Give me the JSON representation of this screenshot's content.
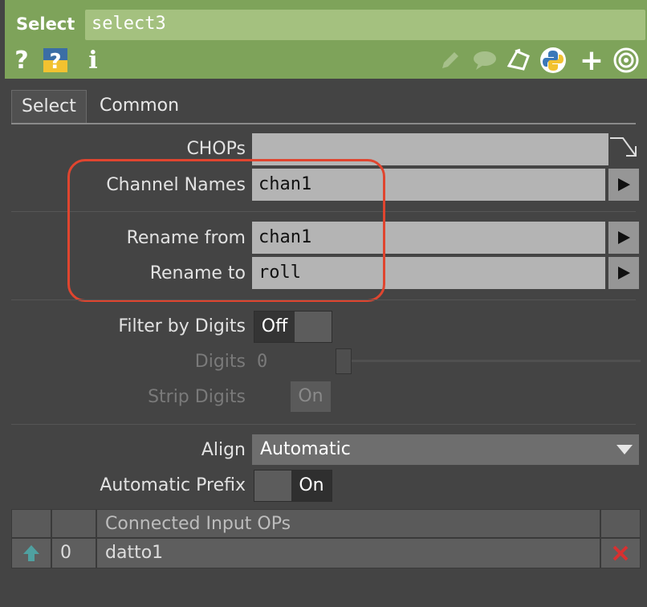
{
  "header": {
    "op_type": "Select",
    "op_name": "select3",
    "left_icons": [
      "help-icon",
      "python-help-icon",
      "info-icon"
    ],
    "right_icons": [
      "edit-icon",
      "comment-icon",
      "clone-icon",
      "python-icon",
      "add-icon",
      "target-icon"
    ]
  },
  "tabs": [
    {
      "label": "Select",
      "active": true
    },
    {
      "label": "Common",
      "active": false
    }
  ],
  "params": {
    "chops": {
      "label": "CHOPs",
      "value": ""
    },
    "channel_names": {
      "label": "Channel Names",
      "value": "chan1"
    },
    "rename_from": {
      "label": "Rename from",
      "value": "chan1"
    },
    "rename_to": {
      "label": "Rename to",
      "value": "roll"
    },
    "filter_by_digits": {
      "label": "Filter by Digits",
      "value": "Off"
    },
    "digits": {
      "label": "Digits",
      "value": "0"
    },
    "strip_digits": {
      "label": "Strip Digits",
      "value": "On"
    },
    "align": {
      "label": "Align",
      "value": "Automatic"
    },
    "automatic_prefix": {
      "label": "Automatic Prefix",
      "value": "On"
    }
  },
  "inputs_table": {
    "header": "Connected Input OPs",
    "rows": [
      {
        "index": "0",
        "name": "datto1"
      }
    ]
  },
  "colors": {
    "header_bg": "#7ea35a",
    "panel_bg": "#444444",
    "highlight": "#e0452f",
    "delete": "#d83030",
    "up_arrow": "#4fa0a0"
  }
}
